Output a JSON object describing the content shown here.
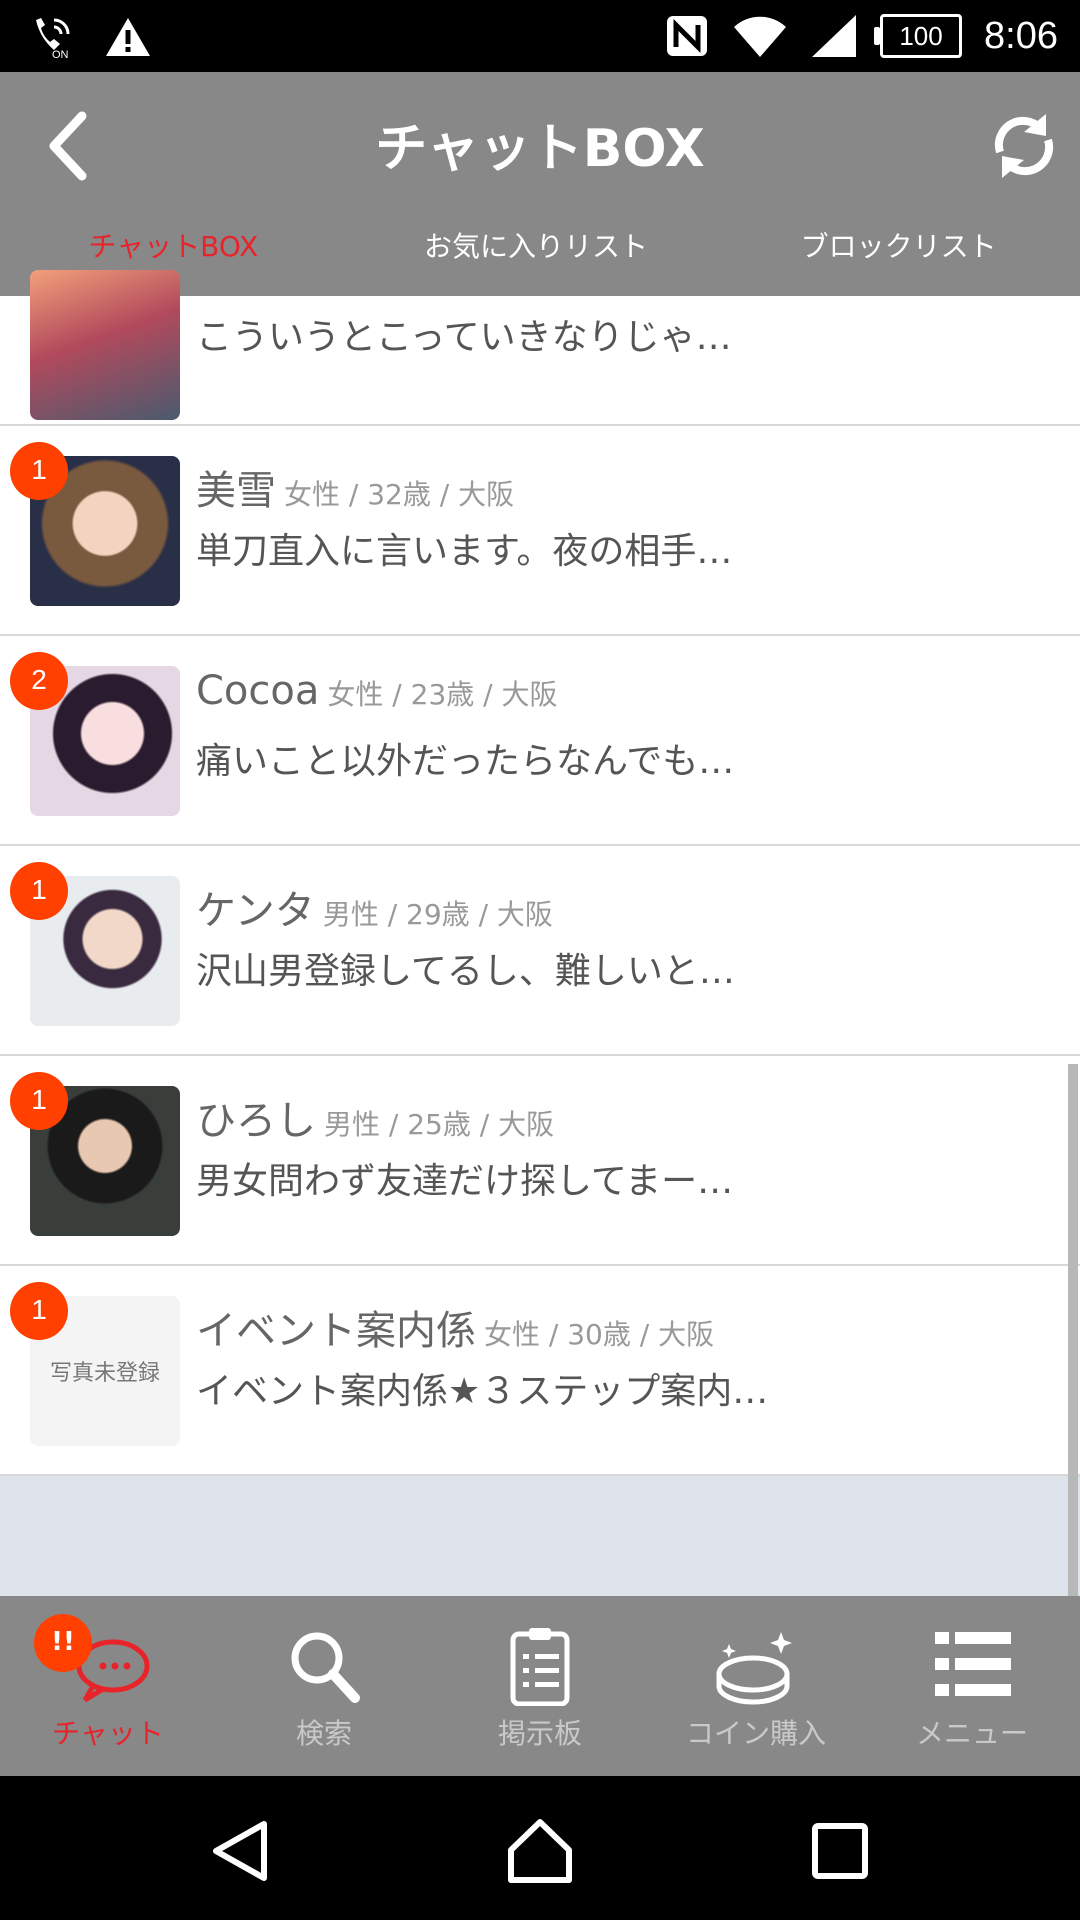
{
  "status_bar": {
    "time": "8:06",
    "battery": "100",
    "icons": [
      "call-wifi-icon",
      "warning-icon",
      "nfc-icon",
      "wifi-icon",
      "signal-icon",
      "battery-icon"
    ]
  },
  "header": {
    "title": "チャットBOX",
    "tabs": [
      {
        "label": "チャットBOX",
        "active": true
      },
      {
        "label": "お気に入りリスト",
        "active": false
      },
      {
        "label": "ブロックリスト",
        "active": false
      }
    ]
  },
  "chats": [
    {
      "message": "こういうとこっていきなりじゃ…"
    },
    {
      "badge": "1",
      "name": "美雪",
      "meta": "女性 / 32歳 / 大阪",
      "message": "単刀直入に言います。夜の相手…"
    },
    {
      "badge": "2",
      "name": "Cocoa",
      "meta": "女性 / 23歳 / 大阪",
      "message": "痛いこと以外だったらなんでも…"
    },
    {
      "badge": "1",
      "name": "ケンタ",
      "meta": "男性 / 29歳 / 大阪",
      "message": "沢山男登録してるし、難しいと…"
    },
    {
      "badge": "1",
      "name": "ひろし",
      "meta": "男性 / 25歳 / 大阪",
      "message": "男女問わず友達だけ探してまー…"
    },
    {
      "badge": "1",
      "name": "イベント案内係",
      "meta": "女性 / 30歳 / 大阪",
      "message": "イベント案内係★３ステップ案内…",
      "no_photo_label": "写真未登録"
    }
  ],
  "bottom_nav": {
    "badge": "!!",
    "items": [
      {
        "label": "チャット",
        "active": true
      },
      {
        "label": "検索",
        "active": false
      },
      {
        "label": "掲示板",
        "active": false
      },
      {
        "label": "コイン購入",
        "active": false
      },
      {
        "label": "メニュー",
        "active": false
      }
    ]
  },
  "colors": {
    "accent": "#e8232a",
    "badge": "#ff4000",
    "header": "#888888"
  }
}
